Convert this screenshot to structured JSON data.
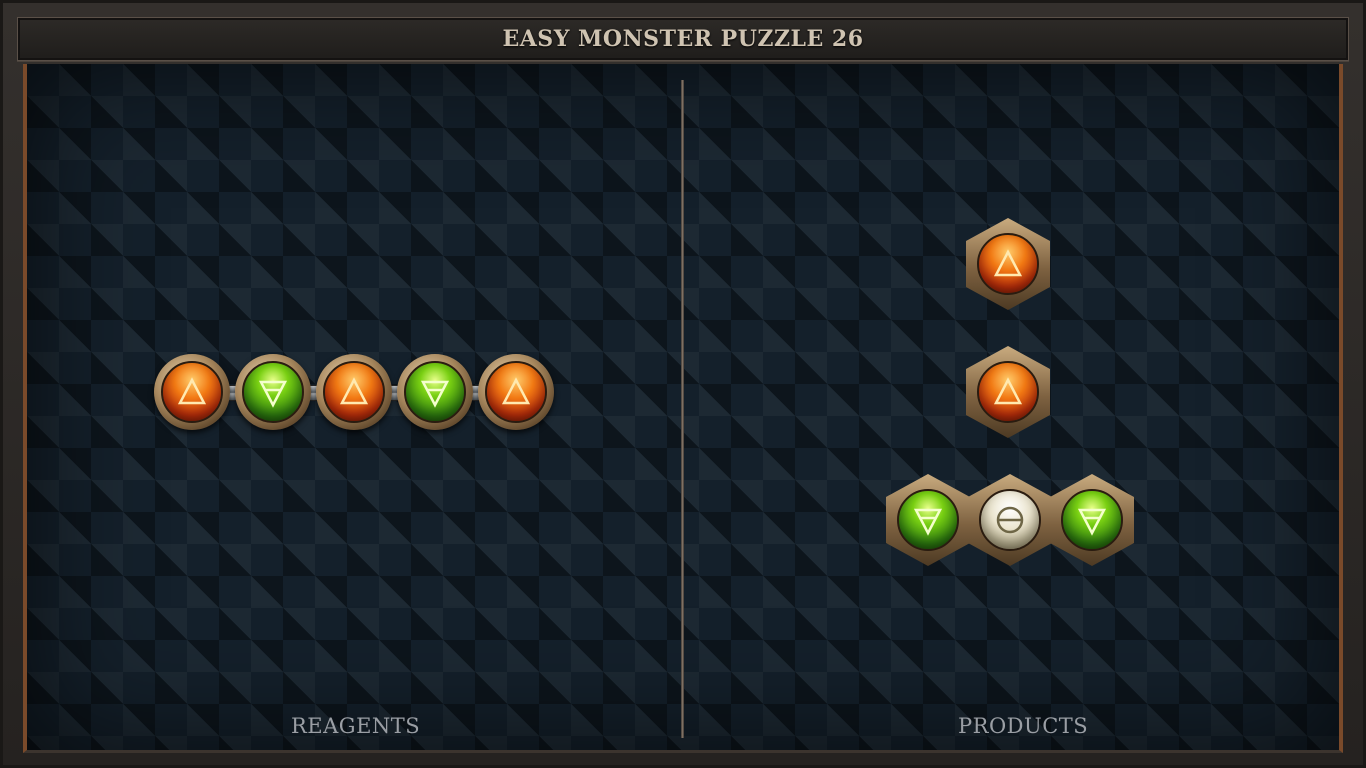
{
  "title": "EASY MONSTER PUZZLE 26",
  "labels": {
    "reagents": "REAGENTS",
    "products": "PRODUCTS"
  },
  "elements": {
    "fire": {
      "icon": "fire-triangle-icon",
      "color": "#e85a12"
    },
    "earth": {
      "icon": "earth-triangle-icon",
      "color": "#5cb817"
    },
    "water": {
      "icon": "theta-circle-icon",
      "color": "#e6e0c9"
    }
  },
  "reagents": [
    {
      "atoms": [
        "fire",
        "earth",
        "fire",
        "earth",
        "fire"
      ]
    }
  ],
  "products": [
    {
      "atoms": [
        "fire"
      ]
    },
    {
      "atoms": [
        "fire"
      ]
    },
    {
      "atoms": [
        "earth",
        "water",
        "earth"
      ]
    }
  ]
}
